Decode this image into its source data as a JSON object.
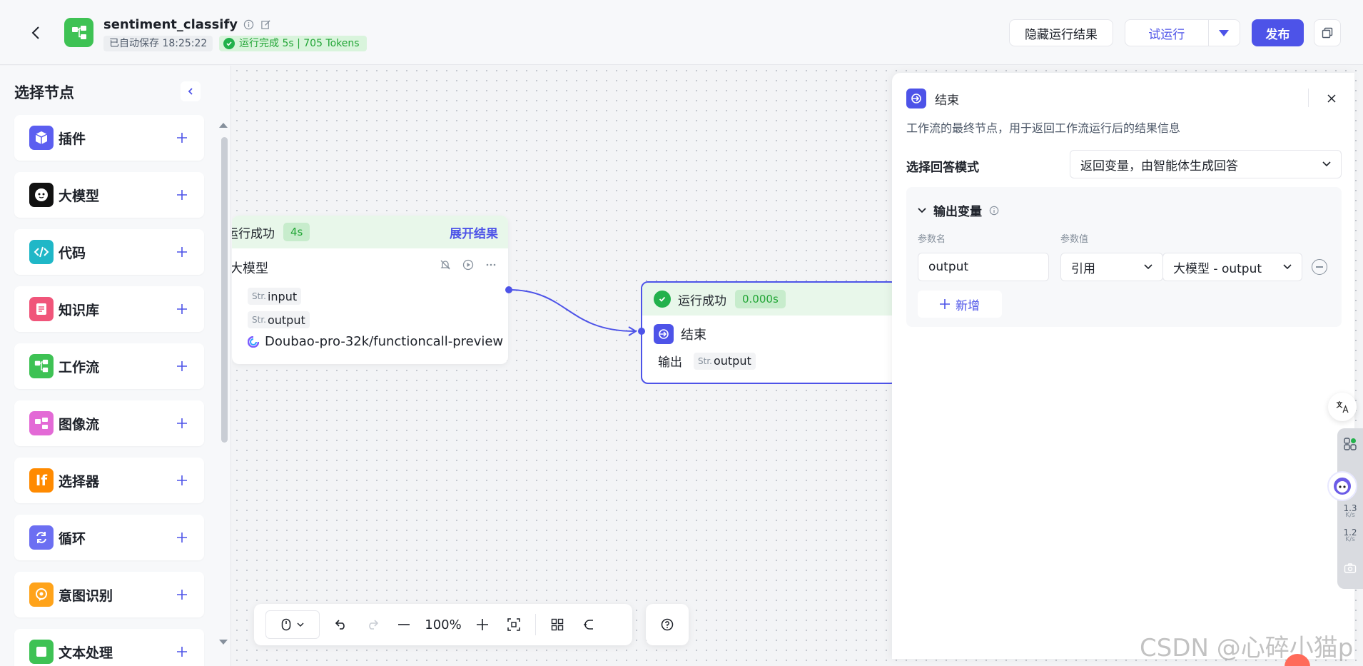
{
  "header": {
    "app_name": "sentiment_classify",
    "autosave": "已自动保存 18:25:22",
    "run_status": "运行完成 5s | 705 Tokens",
    "hide_results": "隐藏运行结果",
    "test_run": "试运行",
    "publish": "发布"
  },
  "sidebar": {
    "title": "选择节点",
    "items": [
      {
        "label": "插件",
        "color": "#5b5ef0",
        "icon": "cube-icon"
      },
      {
        "label": "大模型",
        "color": "#111111",
        "icon": "llm-face-icon"
      },
      {
        "label": "代码",
        "color": "#1fb7c7",
        "icon": "code-icon"
      },
      {
        "label": "知识库",
        "color": "#f0557a",
        "icon": "document-icon"
      },
      {
        "label": "工作流",
        "color": "#3ec254",
        "icon": "workflow-icon"
      },
      {
        "label": "图像流",
        "color": "#e36ad6",
        "icon": "image-flow-icon"
      },
      {
        "label": "选择器",
        "color": "#ff8a00",
        "icon": "if-icon"
      },
      {
        "label": "循环",
        "color": "#6c6ff2",
        "icon": "loop-icon"
      },
      {
        "label": "意图识别",
        "color": "#ffa31a",
        "icon": "intent-icon"
      },
      {
        "label": "文本处理",
        "color": "#3ec254",
        "icon": "text-process-icon"
      }
    ]
  },
  "canvas": {
    "llm_node": {
      "status": "运行成功",
      "time": "4s",
      "expand": "展开结果",
      "name": "大模型",
      "inputs": [
        {
          "type": "Str.",
          "name": "input"
        }
      ],
      "outputs": [
        {
          "type": "Str.",
          "name": "output"
        }
      ],
      "model": "Doubao-pro-32k/functioncall-preview"
    },
    "end_node": {
      "status": "运行成功",
      "time": "0.000s",
      "name": "结束",
      "output_label": "输出",
      "output_type": "Str.",
      "output_name": "output"
    },
    "toolbar": {
      "zoom": "100%"
    }
  },
  "panel": {
    "title": "结束",
    "description": "工作流的最终节点，用于返回工作流运行后的结果信息",
    "mode_label": "选择回答模式",
    "mode_value": "返回变量，由智能体生成回答",
    "section_title": "输出变量",
    "col_name": "参数名",
    "col_value": "参数值",
    "row": {
      "name": "output",
      "ref_type": "引用",
      "ref_value": "大模型 - output"
    },
    "add": "新增"
  },
  "floating": {
    "up_speed": "1.3",
    "up_unit": "K/s",
    "down_speed": "1.2",
    "down_unit": "K/s"
  },
  "watermark": "CSDN @心碎小猫p"
}
